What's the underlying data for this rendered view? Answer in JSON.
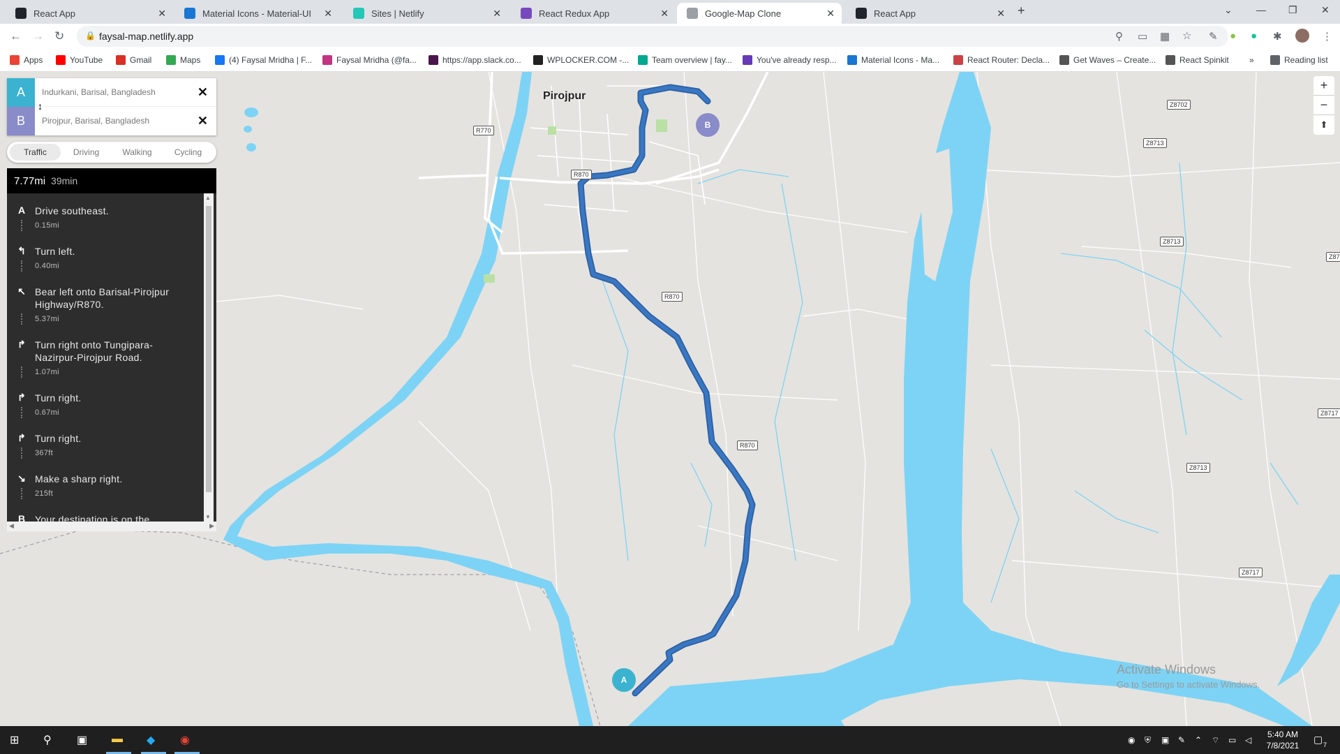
{
  "browser": {
    "tabs": [
      {
        "title": "React App",
        "color": "#20232a"
      },
      {
        "title": "Material Icons - Material-UI",
        "color": "#1976d2"
      },
      {
        "title": "Sites | Netlify",
        "color": "#25c7b7"
      },
      {
        "title": "React Redux App",
        "color": "#764abc"
      },
      {
        "title": "Google-Map Clone",
        "color": "#9aa0a6"
      },
      {
        "title": "React App",
        "color": "#20232a"
      }
    ],
    "active_tab_index": 4,
    "url": "faysal-map.netlify.app",
    "bookmarks": [
      {
        "label": "Apps",
        "icon": "apps-icon",
        "color": "#ea4335"
      },
      {
        "label": "YouTube",
        "icon": "youtube-icon",
        "color": "#ff0000"
      },
      {
        "label": "Gmail",
        "icon": "gmail-icon",
        "color": "#d93025"
      },
      {
        "label": "Maps",
        "icon": "maps-icon",
        "color": "#34a853"
      },
      {
        "label": "(4) Faysal Mridha | F...",
        "icon": "facebook-icon",
        "color": "#1877f2"
      },
      {
        "label": "Faysal Mridha (@fa...",
        "icon": "instagram-icon",
        "color": "#c13584"
      },
      {
        "label": "https://app.slack.co...",
        "icon": "slack-icon",
        "color": "#4a154b"
      },
      {
        "label": "WPLOCKER.COM -...",
        "icon": "wplocker-icon",
        "color": "#222222"
      },
      {
        "label": "Team overview | fay...",
        "icon": "team-icon",
        "color": "#00a88f"
      },
      {
        "label": "You've already resp...",
        "icon": "forms-icon",
        "color": "#673ab7"
      },
      {
        "label": "Material Icons - Ma...",
        "icon": "material-icon",
        "color": "#1976d2"
      },
      {
        "label": "React Router: Decla...",
        "icon": "router-icon",
        "color": "#ca4245"
      },
      {
        "label": "Get Waves – Create...",
        "icon": "globe-icon",
        "color": "#555555"
      },
      {
        "label": "React Spinkit",
        "icon": "globe-icon",
        "color": "#555555"
      }
    ],
    "more_bookmarks": "»",
    "reading_list": "Reading list"
  },
  "directions": {
    "origin": {
      "badge": "A",
      "value": "Indurkani, Barisal, Bangladesh",
      "color": "#3bb2d0"
    },
    "destination": {
      "badge": "B",
      "value": "Pirojpur, Barisal, Bangladesh",
      "color": "#8a8bc9"
    },
    "modes": [
      "Traffic",
      "Driving",
      "Walking",
      "Cycling"
    ],
    "active_mode": "Traffic",
    "summary": {
      "distance": "7.77mi",
      "duration": "39min"
    },
    "steps": [
      {
        "icon": "A",
        "text": "Drive southeast.",
        "distance": "0.15mi",
        "name": "depart-icon"
      },
      {
        "icon": "↰",
        "text": "Turn left.",
        "distance": "0.40mi",
        "name": "turn-left-icon"
      },
      {
        "icon": "↖",
        "text": "Bear left onto Barisal-Pirojpur Highway/R870.",
        "distance": "5.37mi",
        "name": "bear-left-icon"
      },
      {
        "icon": "↱",
        "text": "Turn right onto Tungipara-Nazirpur-Pirojpur Road.",
        "distance": "1.07mi",
        "name": "turn-right-icon"
      },
      {
        "icon": "↱",
        "text": "Turn right.",
        "distance": "0.67mi",
        "name": "turn-right-icon"
      },
      {
        "icon": "↱",
        "text": "Turn right.",
        "distance": "367ft",
        "name": "turn-right-icon"
      },
      {
        "icon": "↘",
        "text": "Make a sharp right.",
        "distance": "215ft",
        "name": "sharp-right-icon"
      },
      {
        "icon": "B",
        "text": "Your destination is on the",
        "distance": "",
        "name": "arrive-icon"
      }
    ]
  },
  "map": {
    "town_label": "Pirojpur",
    "road_shields": [
      "R770",
      "R870",
      "R870",
      "R870",
      "Z8702",
      "Z8713",
      "Z8713",
      "Z8713",
      "Z8717",
      "Z8717",
      "Z87"
    ],
    "marker_a": "A",
    "marker_b": "B",
    "zoom_in": "+",
    "zoom_out": "−",
    "compass": "⬆",
    "water_color": "#7dd3f5",
    "route_color": "#3a77c2",
    "watermark_title": "Activate Windows",
    "watermark_sub": "Go to Settings to activate Windows."
  },
  "taskbar": {
    "time": "5:40 AM",
    "date": "7/8/2021",
    "notification_count": "7"
  }
}
